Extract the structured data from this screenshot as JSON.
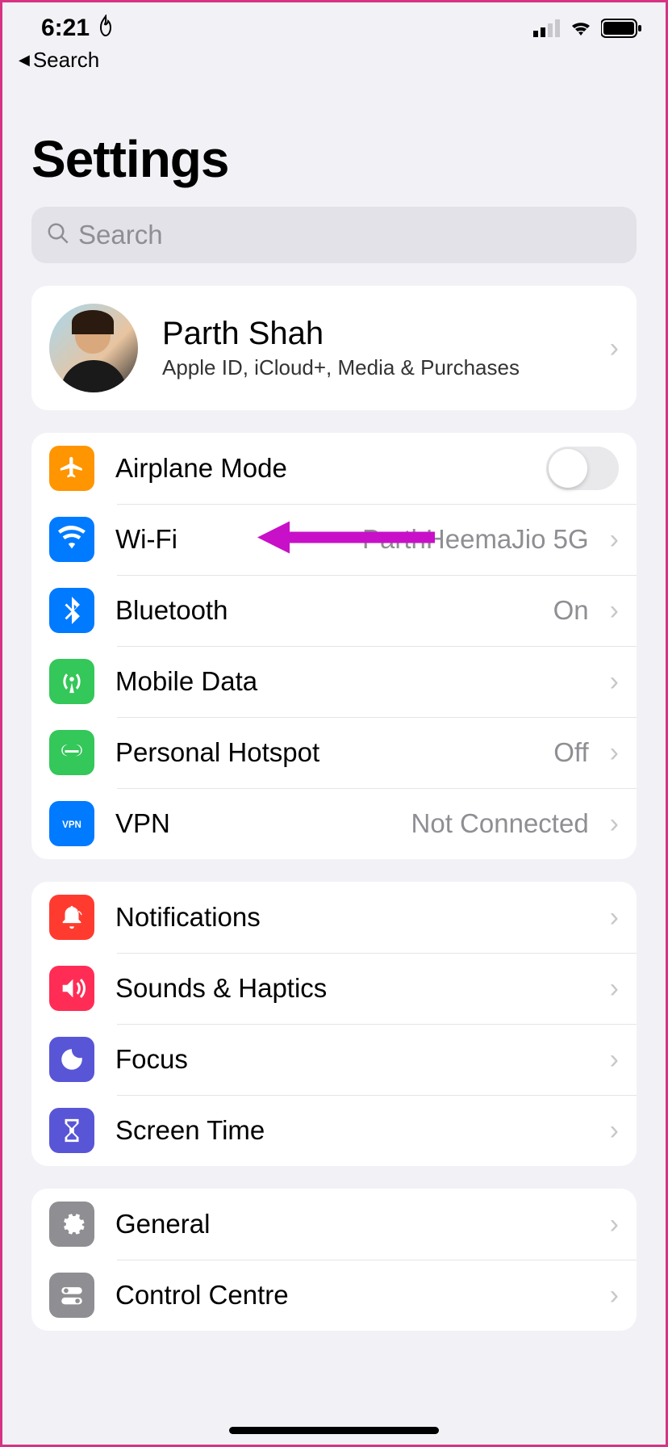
{
  "status": {
    "time": "6:21",
    "back_label": "Search"
  },
  "page": {
    "title": "Settings",
    "search_placeholder": "Search"
  },
  "profile": {
    "name": "Parth Shah",
    "subtitle": "Apple ID, iCloud+, Media & Purchases"
  },
  "connectivity": {
    "airplane": "Airplane Mode",
    "wifi_label": "Wi-Fi",
    "wifi_value": "ParthHeemaJio 5G",
    "bluetooth_label": "Bluetooth",
    "bluetooth_value": "On",
    "mobile_data": "Mobile Data",
    "hotspot_label": "Personal Hotspot",
    "hotspot_value": "Off",
    "vpn_label": "VPN",
    "vpn_value": "Not Connected"
  },
  "system": {
    "notifications": "Notifications",
    "sounds": "Sounds & Haptics",
    "focus": "Focus",
    "screentime": "Screen Time"
  },
  "general_group": {
    "general": "General",
    "control_centre": "Control Centre"
  }
}
